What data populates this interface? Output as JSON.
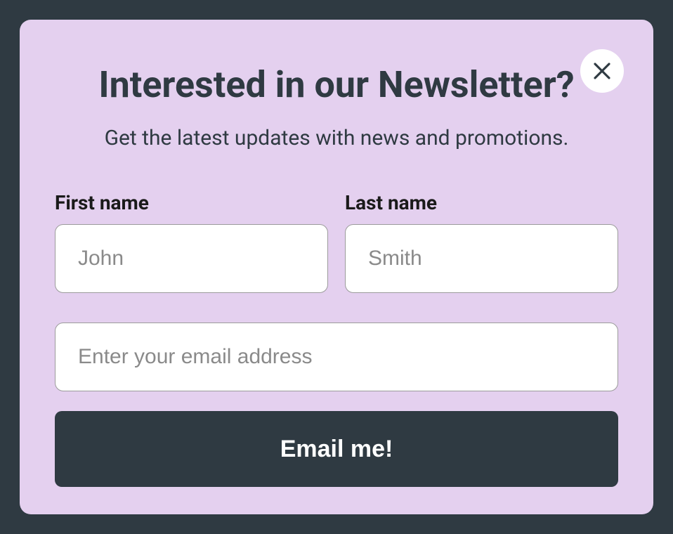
{
  "modal": {
    "heading": "Interested in our Newsletter?",
    "subheading": "Get the latest updates with news and promotions.",
    "fields": {
      "first_name": {
        "label": "First name",
        "placeholder": "John"
      },
      "last_name": {
        "label": "Last name",
        "placeholder": "Smith"
      },
      "email": {
        "placeholder": "Enter your email address"
      }
    },
    "submit_label": "Email me!"
  }
}
